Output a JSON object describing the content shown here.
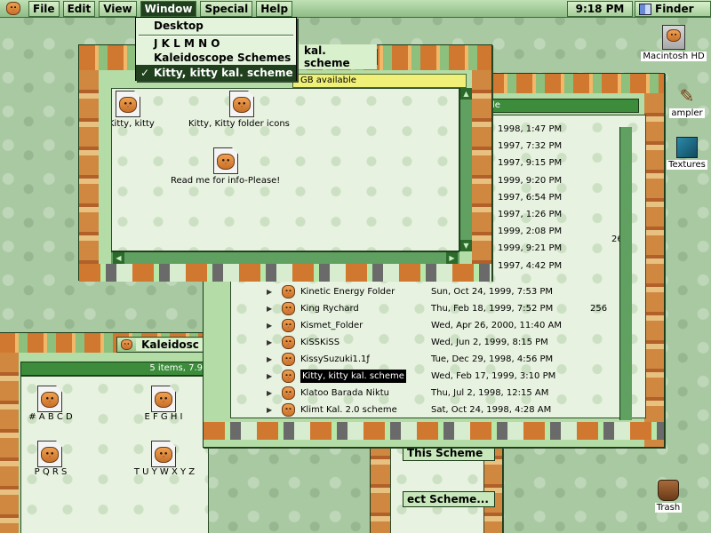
{
  "menubar": {
    "items": [
      "File",
      "Edit",
      "View",
      "Window",
      "Special",
      "Help"
    ],
    "clock": "9:18 PM",
    "app": "Finder"
  },
  "window_menu": {
    "items": [
      "Desktop",
      "J K L M N O",
      "Kaleidoscope Schemes",
      "Kitty, kitty  kal. scheme"
    ],
    "checked": "✓"
  },
  "front_window": {
    "title": "kal. scheme",
    "info": "GB available",
    "icons": [
      {
        "label": "Kitty, kitty"
      },
      {
        "label": "Kitty, Kitty folder icons"
      },
      {
        "label": "Read me for info-Please!"
      }
    ]
  },
  "list_window": {
    "header_fragment": "le",
    "partial_dates": [
      "1998, 1:47 PM",
      "1997, 7:32 PM",
      "1997, 9:15 PM",
      "1999, 9:20 PM",
      "1997, 6:54 PM",
      "1997, 1:26 PM",
      "1999, 2:08 PM",
      "1999, 9:21 PM",
      "1997, 4:42 PM"
    ],
    "partial_size": "26",
    "rows": [
      {
        "name": "Kinetic Energy Folder",
        "date": "Sun, Oct 24, 1999, 7:53 PM",
        "size": ""
      },
      {
        "name": "King Rychard",
        "date": "Thu, Feb 18, 1999, 7:52 PM",
        "size": "256"
      },
      {
        "name": "Kismet_Folder",
        "date": "Wed, Apr 26, 2000, 11:40 AM",
        "size": ""
      },
      {
        "name": "KiSSKiSS",
        "date": "Wed, Jun 2, 1999, 8:15 PM",
        "size": ""
      },
      {
        "name": "KissySuzuki1.1ƒ",
        "date": "Tue, Dec 29, 1998, 4:56 PM",
        "size": ""
      },
      {
        "name": "Kitty, kitty  kal. scheme",
        "date": "Wed, Feb 17, 1999, 3:10 PM",
        "size": ""
      },
      {
        "name": "Klatoo Barada Niktu",
        "date": "Thu, Jul 2, 1998, 12:15 AM",
        "size": ""
      },
      {
        "name": "Klimt Kal. 2.0 scheme",
        "date": "Sat, Oct 24, 1998, 4:28 AM",
        "size": ""
      }
    ]
  },
  "left_window": {
    "title": "Kaleidosc",
    "info": "5 items, 7.9",
    "icons": [
      "# A B C D",
      "E F G H I",
      "P Q R S",
      "T U Y W X Y Z"
    ]
  },
  "bottom_window": {
    "buttons": [
      "This Scheme",
      "ect Scheme..."
    ]
  },
  "desktop_icons": [
    "Macintosh HD",
    "ampler",
    "Textures",
    "Trash"
  ]
}
